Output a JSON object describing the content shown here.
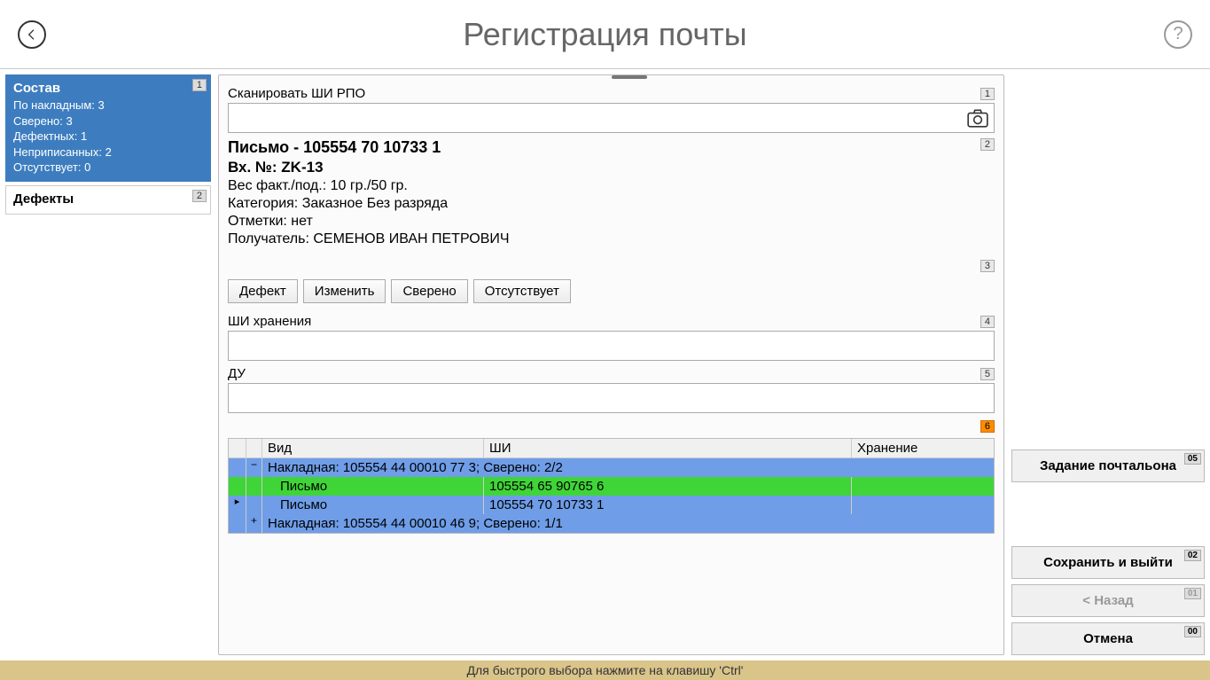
{
  "header": {
    "title": "Регистрация почты"
  },
  "left": {
    "compose": {
      "title": "Состав",
      "badge": "1",
      "lines": [
        "По накладным: 3",
        "Сверено: 3",
        "Дефектных: 1",
        "Неприписанных: 2",
        "Отсутствует: 0"
      ]
    },
    "defects": {
      "title": "Дефекты",
      "badge": "2"
    }
  },
  "scan": {
    "label": "Сканировать ШИ РПО",
    "badge": "1",
    "value": ""
  },
  "detail": {
    "badge": "2",
    "headline": "Письмо - 105554 70 10733 1",
    "incoming": "Вх. №: ZK-13",
    "weight": "Вес факт./под.: 10 гр./50 гр.",
    "category": "Категория: Заказное Без разряда",
    "marks": "Отметки: нет",
    "recipient": "Получатель: СЕМЕНОВ ИВАН ПЕТРОВИЧ"
  },
  "actions": {
    "badge": "3",
    "defect": "Дефект",
    "edit": "Изменить",
    "verified": "Сверено",
    "absent": "Отсутствует"
  },
  "storage": {
    "label": "ШИ хранения",
    "badge": "4",
    "value": ""
  },
  "du": {
    "label": "ДУ",
    "badge": "5",
    "value": ""
  },
  "grid": {
    "badge": "6",
    "headers": {
      "vid": "Вид",
      "shi": "ШИ",
      "storage": "Хранение"
    },
    "rows": [
      {
        "type": "group",
        "tree": "−",
        "text": "Накладная: 105554 44 00010 77 3; Сверено: 2/2"
      },
      {
        "type": "leaf",
        "class": "green",
        "vid": "Письмо",
        "shi": "105554 65 90765 6",
        "storage": ""
      },
      {
        "type": "leaf",
        "class": "blue-sel",
        "ptr": "▸",
        "vid": "Письмо",
        "shi": "105554 70 10733 1",
        "storage": ""
      },
      {
        "type": "group",
        "tree": "+",
        "text": "Накладная: 105554 44 00010 46 9; Сверено: 1/1"
      }
    ]
  },
  "right": {
    "postman": {
      "label": "Задание почтальона",
      "badge": "05"
    },
    "save": {
      "label": "Сохранить и выйти",
      "badge": "02"
    },
    "back": {
      "label": "< Назад",
      "badge": "01"
    },
    "cancel": {
      "label": "Отмена",
      "badge": "00"
    }
  },
  "footer": "Для быстрого выбора нажмите на клавишу 'Ctrl'"
}
